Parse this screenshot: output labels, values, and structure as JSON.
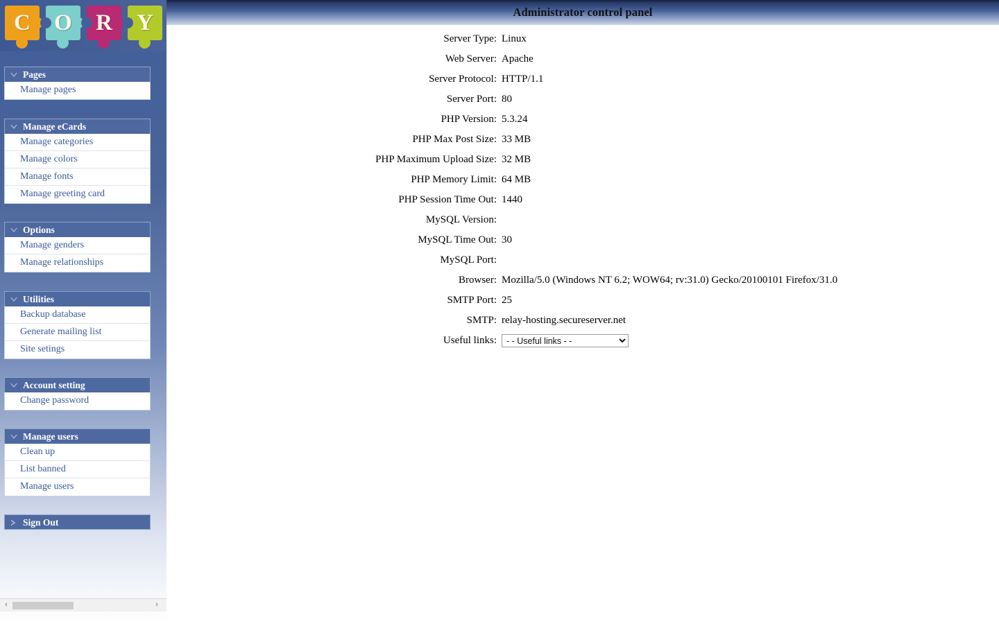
{
  "header": {
    "title": "Administrator control panel"
  },
  "logo": {
    "name": "cory-logo",
    "pieces": [
      {
        "letter": "C",
        "color": "#efa01b"
      },
      {
        "letter": "O",
        "color": "#7ccfcb"
      },
      {
        "letter": "R",
        "color": "#b92a72"
      },
      {
        "letter": "Y",
        "color": "#b3cb2a"
      }
    ]
  },
  "sidebar": {
    "groups": [
      {
        "title": "Pages",
        "icon": "chevron-down-icon",
        "items": [
          {
            "label": "Manage pages"
          }
        ]
      },
      {
        "title": "Manage eCards",
        "icon": "chevron-down-icon",
        "items": [
          {
            "label": "Manage categories"
          },
          {
            "label": "Manage colors"
          },
          {
            "label": "Manage fonts"
          },
          {
            "label": "Manage greeting card"
          }
        ]
      },
      {
        "title": "Options",
        "icon": "chevron-down-icon",
        "items": [
          {
            "label": "Manage genders"
          },
          {
            "label": "Manage relationships"
          }
        ]
      },
      {
        "title": "Utilities",
        "icon": "chevron-down-icon",
        "items": [
          {
            "label": "Backup database"
          },
          {
            "label": "Generate mailing list"
          },
          {
            "label": "Site setings"
          }
        ]
      },
      {
        "title": "Account setting",
        "icon": "chevron-down-icon",
        "items": [
          {
            "label": "Change password"
          }
        ]
      },
      {
        "title": "Manage users",
        "icon": "chevron-down-icon",
        "items": [
          {
            "label": "Clean up"
          },
          {
            "label": "List banned"
          },
          {
            "label": "Manage users"
          }
        ]
      },
      {
        "title": "Sign Out",
        "icon": "chevron-right-icon",
        "items": []
      }
    ],
    "scrollbar": {
      "left_arrow": "‹",
      "right_arrow": "›"
    }
  },
  "main": {
    "rows": [
      {
        "label": "Server Type:",
        "value": "Linux"
      },
      {
        "label": "Web Server:",
        "value": "Apache"
      },
      {
        "label": "Server Protocol:",
        "value": "HTTP/1.1"
      },
      {
        "label": "Server Port:",
        "value": "80"
      },
      {
        "label": "PHP Version:",
        "value": "5.3.24"
      },
      {
        "label": "PHP Max Post Size:",
        "value": "33 MB"
      },
      {
        "label": "PHP Maximum Upload Size:",
        "value": "32 MB"
      },
      {
        "label": "PHP Memory Limit:",
        "value": "64 MB"
      },
      {
        "label": "PHP Session Time Out:",
        "value": "1440"
      },
      {
        "label": "MySQL Version:",
        "value": ""
      },
      {
        "label": "MySQL Time Out:",
        "value": "30"
      },
      {
        "label": "MySQL Port:",
        "value": ""
      },
      {
        "label": "Browser:",
        "value": "Mozilla/5.0 (Windows NT 6.2; WOW64; rv:31.0) Gecko/20100101 Firefox/31.0"
      },
      {
        "label": "SMTP Port:",
        "value": "25"
      },
      {
        "label": "SMTP:",
        "value": "relay-hosting.secureserver.net"
      }
    ],
    "useful_links": {
      "label": "Useful links:",
      "selected": "- - Useful links - -",
      "options": [
        "- - Useful links - -"
      ]
    }
  },
  "colors": {
    "header_dark": "#16203c",
    "header_light": "#ccd5e8",
    "sidebar_blue": "#44609a",
    "group_head": "#4e68a0",
    "menu_link": "#3b5a9b"
  }
}
